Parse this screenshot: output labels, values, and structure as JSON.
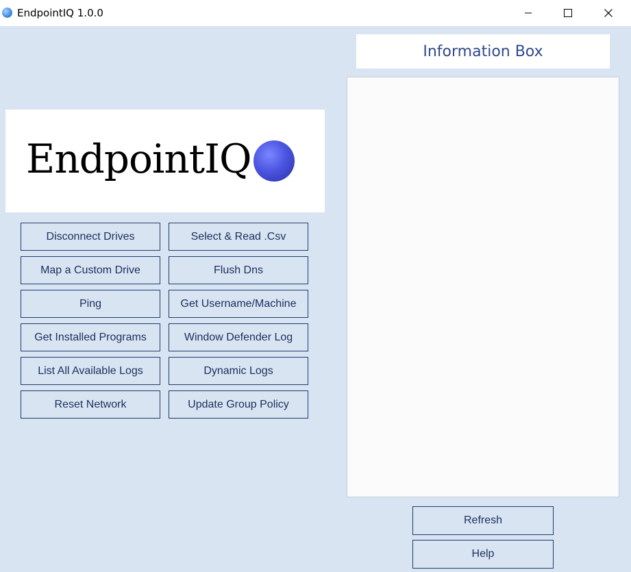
{
  "window": {
    "title": "EndpointIQ 1.0.0",
    "icon": "blue-sphere-icon"
  },
  "info_box": {
    "title": "Information Box",
    "content": ""
  },
  "logo": {
    "text": "EndpointIQ",
    "icon": "blue-sphere-icon"
  },
  "actions": {
    "left": [
      "Disconnect Drives",
      "Map a Custom Drive",
      "Ping",
      "Get Installed Programs",
      "List All Available Logs",
      "Reset Network"
    ],
    "right": [
      "Select & Read .Csv",
      "Flush Dns",
      "Get Username/Machine",
      "Window Defender Log",
      "Dynamic Logs",
      "Update Group Policy"
    ]
  },
  "footer": {
    "refresh_label": "Refresh",
    "help_label": "Help"
  },
  "colors": {
    "background": "#d9e4f2",
    "button_border": "#1f3a6e",
    "button_text": "#1a2f5c",
    "info_title": "#2f4a8a",
    "logo_sphere": "#4c55e0"
  }
}
